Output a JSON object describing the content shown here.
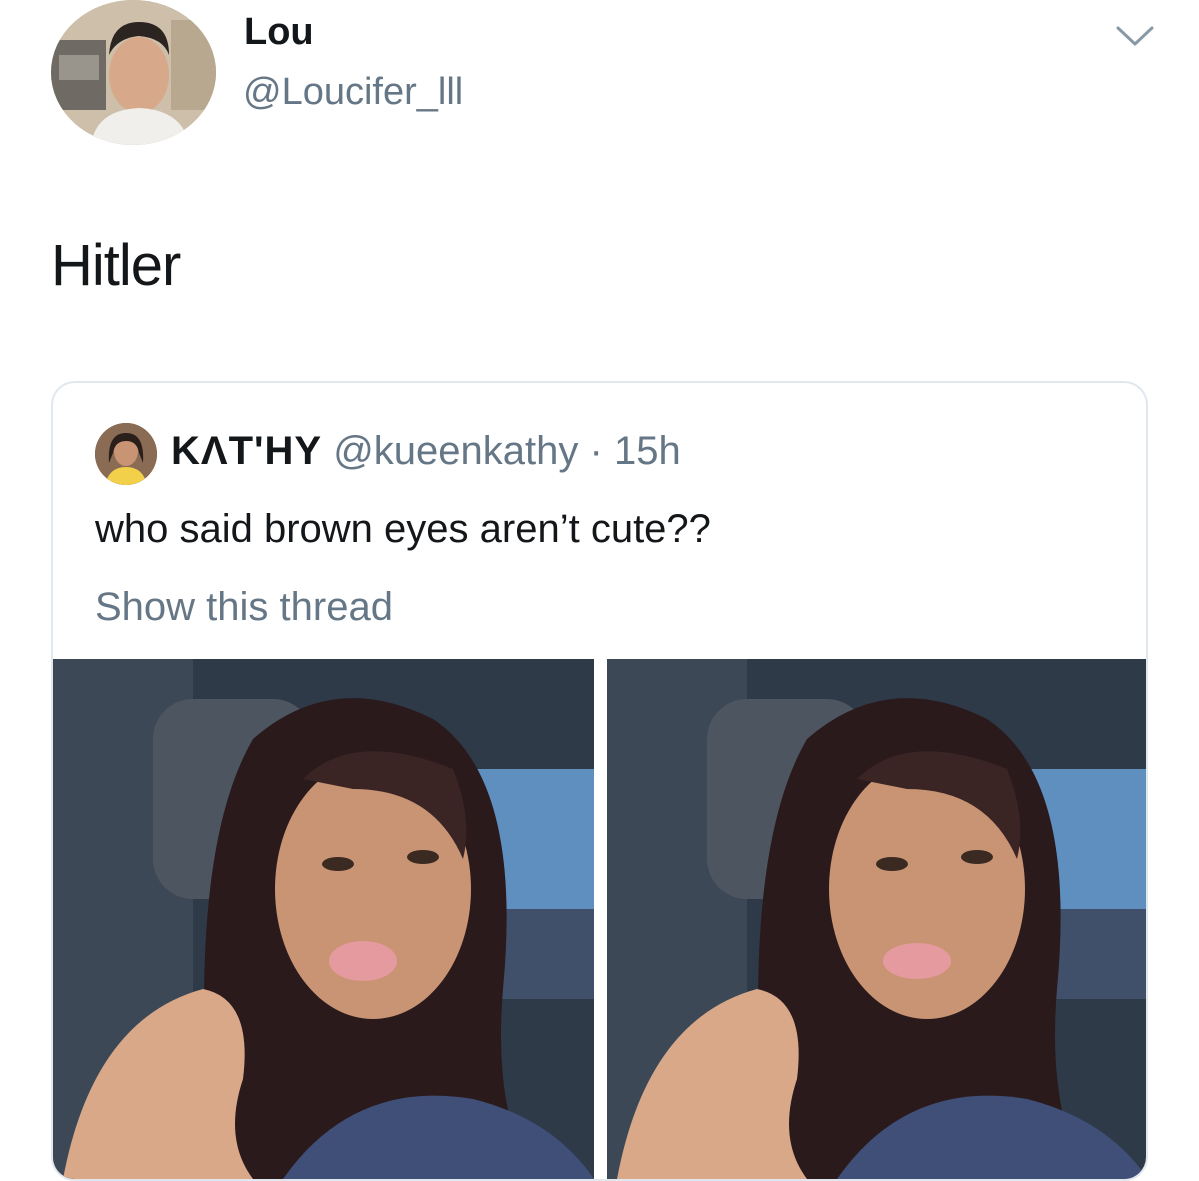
{
  "author": {
    "display_name": "Lou",
    "handle": "@Loucifer_lll",
    "avatar_icon": "profile-photo"
  },
  "tweet": {
    "text": "Hitler"
  },
  "quoted_tweet": {
    "display_name": "KΛT'HY",
    "handle": "@kueenkathy",
    "separator": "·",
    "time": "15h",
    "text": "who said brown eyes aren’t cute??",
    "show_thread_label": "Show this thread",
    "media": [
      {
        "icon": "selfie-photo"
      },
      {
        "icon": "selfie-photo"
      }
    ]
  },
  "colors": {
    "text_primary": "#14171a",
    "text_secondary": "#657786",
    "card_border": "#e1e8ed"
  },
  "icons": {
    "caret": "chevron-down-icon"
  }
}
